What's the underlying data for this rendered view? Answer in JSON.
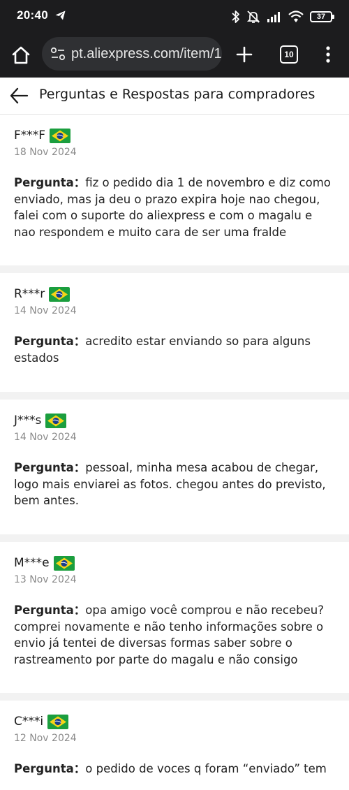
{
  "status_bar": {
    "time": "20:40",
    "battery": "37",
    "icons": [
      "send-icon",
      "bluetooth-icon",
      "mute-icon",
      "signal-icon",
      "wifi-icon",
      "battery-icon"
    ]
  },
  "browser": {
    "url": "pt.aliexpress.com/item/1",
    "tab_count": "10"
  },
  "header": {
    "title": "Perguntas e Respostas para compradores"
  },
  "question_label": "Pergunta：",
  "flag_colors": {
    "green": "#1b9e3e",
    "yellow": "#f7d417",
    "blue": "#1a3e8c"
  },
  "questions": [
    {
      "user": "F***F",
      "date": "18 Nov 2024",
      "text": "fiz o pedido dia 1 de novembro e diz como enviado, mas ja deu o prazo expira hoje nao chegou, falei com o suporte do aliexpress e com o magalu e nao respondem e muito cara de ser uma fralde"
    },
    {
      "user": "R***r",
      "date": "14 Nov 2024",
      "text": "acredito estar enviando so para alguns estados"
    },
    {
      "user": "J***s",
      "date": "14 Nov 2024",
      "text": "pessoal, minha mesa acabou de chegar, logo mais enviarei as fotos. chegou antes do previsto, bem antes."
    },
    {
      "user": "M***e",
      "date": "13 Nov 2024",
      "text": "opa amigo você comprou e não recebeu? comprei novamente e não tenho informações sobre o envio já tentei de diversas formas saber sobre o rastreamento por parte do magalu e não consigo"
    },
    {
      "user": "C***i",
      "date": "12 Nov 2024",
      "text": "o pedido de voces q foram “enviado” tem"
    }
  ]
}
